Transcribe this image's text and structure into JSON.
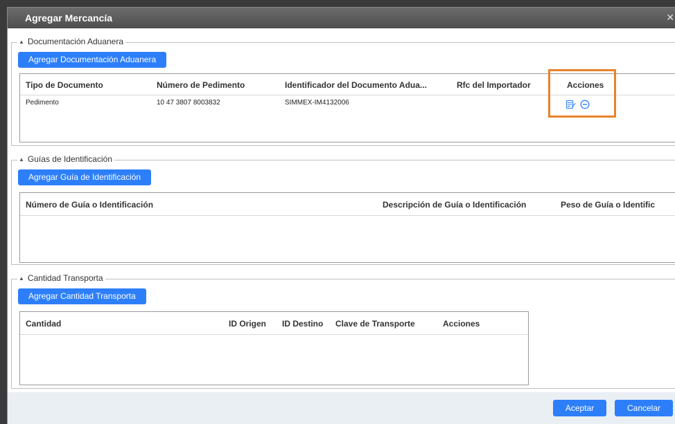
{
  "dialog": {
    "title": "Agregar Mercancía",
    "close_glyph": "✕"
  },
  "customs_section": {
    "legend": "Documentación Aduanera",
    "add_button": "Agregar Documentación Aduanera",
    "columns": [
      "Tipo de Documento",
      "Número de Pedimento",
      "Identificador del Documento Adua...",
      "Rfc del Importador",
      "Acciones"
    ],
    "rows": [
      {
        "tipo": "Pedimento",
        "numero": "10 47 3807 8003832",
        "identificador": "SIMMEX-IM4132006",
        "rfc": ""
      }
    ],
    "actions": {
      "edit_icon": "edit-icon",
      "remove_icon": "remove-icon"
    },
    "highlight_color": "#e8822a"
  },
  "guides_section": {
    "legend": "Guías de Identificación",
    "add_button": "Agregar Guía de Identificación",
    "columns": [
      "Número de Guía o Identificación",
      "Descripción de Guía o Identificación",
      "Peso de Guía o Identific"
    ]
  },
  "transport_section": {
    "legend": "Cantidad Transporta",
    "add_button": "Agregar Cantidad Transporta",
    "columns": [
      "Cantidad",
      "ID Origen",
      "ID Destino",
      "Clave de Transporte",
      "Acciones"
    ]
  },
  "footer": {
    "accept": "Aceptar",
    "cancel": "Cancelar"
  },
  "colors": {
    "primary": "#2d7ff9",
    "titlebar": "#5a5a5a",
    "footer": "#eaeff4"
  }
}
